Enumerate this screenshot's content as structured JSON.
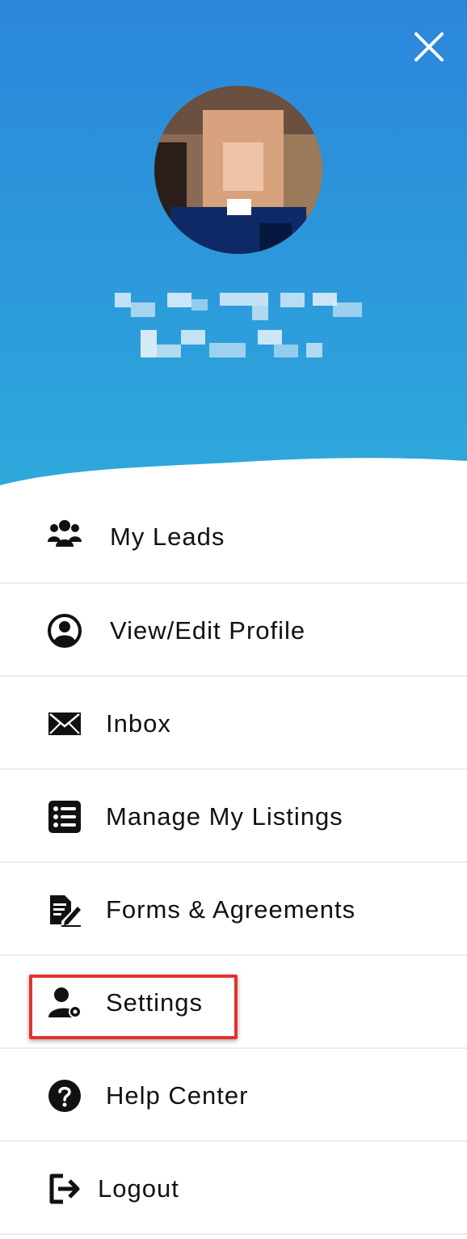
{
  "header": {
    "close_icon": "close-icon",
    "avatar_icon": "user-avatar",
    "gradient_top": "#2b86db",
    "gradient_bottom": "#2ea8db"
  },
  "menu": {
    "items": [
      {
        "label": "My Leads",
        "icon": "users-group-icon"
      },
      {
        "label": "View/Edit Profile",
        "icon": "user-circle-icon"
      },
      {
        "label": "Inbox",
        "icon": "envelope-icon"
      },
      {
        "label": "Manage My Listings",
        "icon": "list-icon"
      },
      {
        "label": "Forms & Agreements",
        "icon": "document-edit-icon"
      },
      {
        "label": "Settings",
        "icon": "user-gear-icon"
      },
      {
        "label": "Help Center",
        "icon": "question-circle-icon"
      },
      {
        "label": "Logout",
        "icon": "logout-icon"
      }
    ]
  },
  "annotation": {
    "highlight_color": "#e3322b"
  }
}
